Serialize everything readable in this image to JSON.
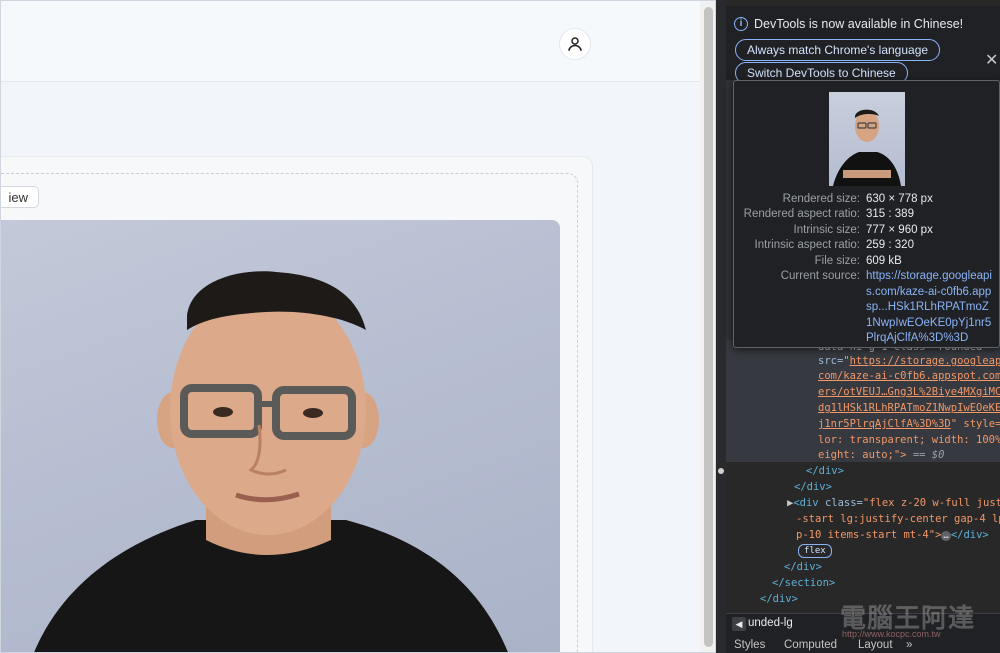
{
  "page": {
    "preview_label": "iew"
  },
  "devtools": {
    "banner": {
      "message": "DevTools is now available in Chinese!",
      "btn_match": "Always match Chrome's language",
      "btn_switch": "Switch DevTools to Chinese",
      "close": "✕"
    },
    "tooltip": {
      "rows": [
        {
          "label": "Rendered size:",
          "value": "630 × 778 px"
        },
        {
          "label": "Rendered aspect ratio:",
          "value": "315 : 389"
        },
        {
          "label": "Intrinsic size:",
          "value": "777 × 960 px"
        },
        {
          "label": "Intrinsic aspect ratio:",
          "value": "259 : 320"
        },
        {
          "label": "File size:",
          "value": "609 kB"
        }
      ],
      "source_label": "Current source:",
      "source_value": "https://storage.googleapis.com/kaze-ai-c0fb6.appsp...HSk1RLhRPATmoZ1NwpIwEOeKE0pYj1nr5PlrqAjClfA%3D%3D"
    },
    "code": {
      "line0": "data-ni  g  1  class=\"rounded",
      "line1_attr": "src=\"",
      "line1_link": "https://storage.googleap",
      "line2": "com/kaze-ai-c0fb6.appspot.com",
      "line3": "ers/otVEUJ…Gng3L%2Biye4MXgiMC",
      "line4": "dg1lHSk1RLhRPATmoZ1NwpIwEOeKE",
      "line5_link": "j1nr5PlrqAjClfA%3D%3D",
      "line5_rest": "\" style=",
      "line6": "lor: transparent; width: 100%",
      "line7": "eight: auto;\">",
      "line7_eq": " == $0",
      "line8": "</div>",
      "line9": "</div>",
      "line10_a": "▶",
      "line10_tag": "<div",
      "line10_attr": " class=",
      "line10_val": "\"flex z-20 w-full just",
      "line11": "-start lg:justify-center gap-4 lp",
      "line12": "p-10 items-start mt-4\">",
      "line12_ell": "…",
      "line12_end": "</div>",
      "flex_badge": "flex",
      "line13": "</div>",
      "line14": "</section>",
      "line15": "</div>"
    },
    "breadcrumb": {
      "arrow": "◀",
      "text": "unded-lg"
    },
    "tabs": {
      "styles": "Styles",
      "computed": "Computed",
      "layout": "Layout",
      "more": "»"
    },
    "watermark": {
      "text": "電腦王阿達",
      "url": "http://www.kocpc.com.tw"
    }
  }
}
